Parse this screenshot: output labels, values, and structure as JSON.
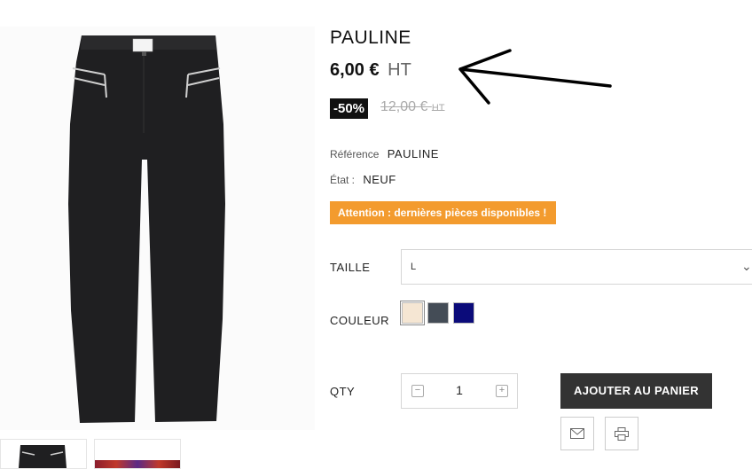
{
  "product": {
    "title": "PAULINE",
    "price": "6,00 €",
    "tax_label": "HT",
    "discount": "-50%",
    "old_price": "12,00 €",
    "old_tax_label": "HT",
    "reference_label": "Référence",
    "reference_value": "PAULINE",
    "condition_label": "État :",
    "condition_value": "NEUF",
    "availability_warning": "Attention : dernières pièces disponibles !"
  },
  "options": {
    "size_label": "TAILLE",
    "size_selected": "L",
    "color_label": "COULEUR",
    "colors": [
      {
        "name": "beige",
        "hex": "#f5e6d3"
      },
      {
        "name": "grey",
        "hex": "#444c56"
      },
      {
        "name": "navy",
        "hex": "#0b0b7a"
      }
    ]
  },
  "cart": {
    "qty_label": "QTY",
    "qty_value": "1",
    "add_button": "AJOUTER AU PANIER"
  },
  "icons": {
    "email": "envelope-icon",
    "print": "printer-icon",
    "minus": "minus-icon",
    "plus": "plus-icon"
  },
  "colors": {
    "warning_bg": "#f39b2e",
    "discount_bg": "#111111",
    "button_bg": "#333333"
  }
}
